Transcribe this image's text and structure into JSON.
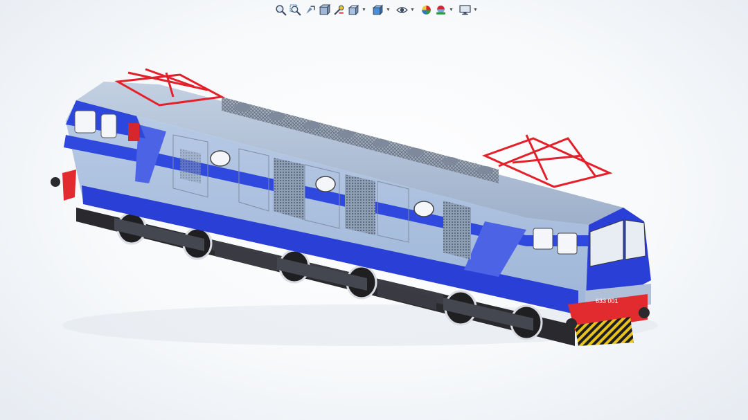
{
  "app": {
    "name": "CAD 3D model viewport"
  },
  "toolbar": {
    "buttons": [
      {
        "name": "zoom-to-fit-icon",
        "dropdown": false
      },
      {
        "name": "zoom-to-area-icon",
        "dropdown": false
      },
      {
        "name": "previous-view-icon",
        "dropdown": false
      },
      {
        "name": "section-view-icon",
        "dropdown": false
      },
      {
        "name": "dynamic-annotation-icon",
        "dropdown": false
      },
      {
        "name": "view-orientation-icon",
        "dropdown": true
      },
      {
        "name": "display-style-icon",
        "dropdown": true
      },
      {
        "name": "hide-show-items-icon",
        "dropdown": true
      },
      {
        "name": "edit-appearance-icon",
        "dropdown": false
      },
      {
        "name": "apply-scene-icon",
        "dropdown": true
      },
      {
        "name": "view-settings-icon",
        "dropdown": true
      }
    ]
  },
  "model": {
    "unit_number": "633 001",
    "colors": {
      "body_light": "#a9c1e2",
      "body_stripe": "#2441d8",
      "body_mid": "#4d63e6",
      "roof": "#a7b7cf",
      "pantograph": "#e2212b",
      "undercarriage": "#2a2a2e",
      "bumper_red": "#e12b2f",
      "hazard_yellow": "#e8c21f"
    }
  }
}
